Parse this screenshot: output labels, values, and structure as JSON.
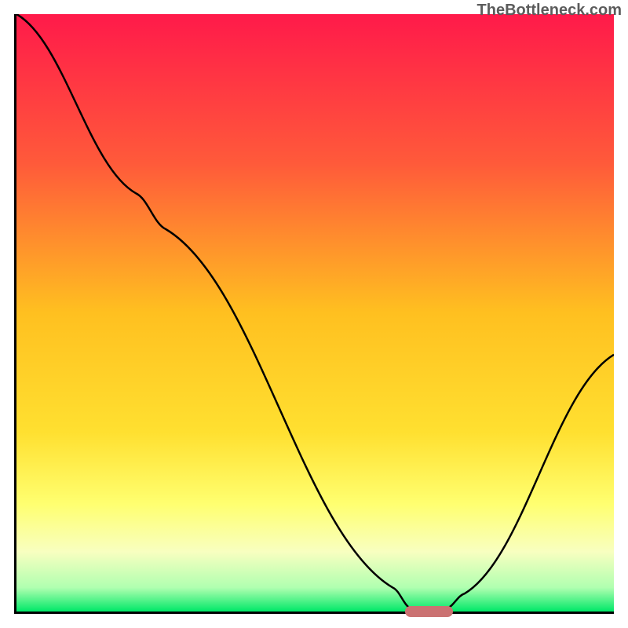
{
  "watermark": "TheBottleneck.com",
  "chart_data": {
    "type": "line",
    "title": "",
    "xlabel": "",
    "ylabel": "",
    "xlim": [
      0,
      100
    ],
    "ylim": [
      0,
      100
    ],
    "curve_points": [
      {
        "x": 0,
        "y": 100
      },
      {
        "x": 20,
        "y": 70
      },
      {
        "x": 25,
        "y": 64
      },
      {
        "x": 63,
        "y": 4
      },
      {
        "x": 66,
        "y": 0.5
      },
      {
        "x": 72,
        "y": 0.5
      },
      {
        "x": 75,
        "y": 3
      },
      {
        "x": 100,
        "y": 43
      }
    ],
    "gradient_stops": [
      {
        "offset": 0,
        "color": "#ff1a4a"
      },
      {
        "offset": 25,
        "color": "#ff5a3a"
      },
      {
        "offset": 50,
        "color": "#ffc020"
      },
      {
        "offset": 70,
        "color": "#ffe030"
      },
      {
        "offset": 82,
        "color": "#ffff70"
      },
      {
        "offset": 90,
        "color": "#f8ffc0"
      },
      {
        "offset": 96,
        "color": "#b0ffb0"
      },
      {
        "offset": 100,
        "color": "#00e868"
      }
    ],
    "marker": {
      "x_start": 65,
      "x_end": 73,
      "y": 0,
      "color": "#cb7272"
    }
  }
}
